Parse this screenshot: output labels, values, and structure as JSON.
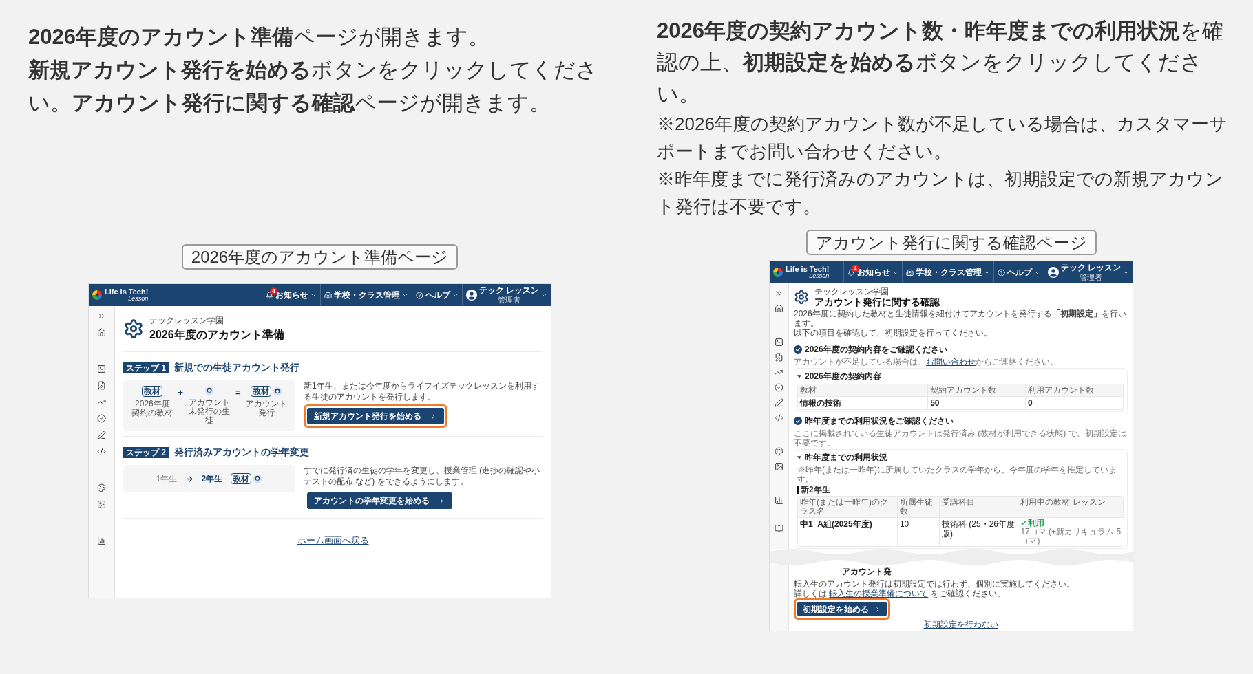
{
  "left": {
    "intro": [
      "**2026年度のアカウント準備**ページが開きます。",
      "**新規アカウント発行を始める**ボタンをクリックしてください。**アカウント発行に関する確認**ページが開きます。"
    ],
    "caption": "2026年度のアカウント準備ページ",
    "screen": {
      "header": {
        "brand": "Life is Tech!",
        "brand_sub": "Lesson",
        "nav": [
          {
            "kind": "notifications",
            "label": "お知らせ",
            "badge": "4"
          },
          {
            "kind": "school",
            "label": "学校・クラス管理"
          },
          {
            "kind": "help",
            "label": "ヘルプ"
          }
        ],
        "user": {
          "name": "テック レッスン",
          "role": "管理者"
        }
      },
      "school": "テックレッスン学園",
      "title": "2026年度のアカウント準備",
      "steps": [
        {
          "badge": "ステップ 1",
          "title": "新規での生徒アカウント発行",
          "illustration": {
            "kind": "formula",
            "book": "教材",
            "operators": [
              "+",
              "="
            ],
            "result_book": "教材",
            "labels": [
              "2026年度契約の教材",
              "アカウント未発行の生徒",
              "アカウント発行"
            ]
          },
          "description": "新1年生、または今年度からライフイズテックレッスンを利用する生徒のアカウントを発行します。",
          "button": "新規アカウント発行を始める",
          "highlighted": true
        },
        {
          "badge": "ステップ 2",
          "title": "発行済みアカウントの学年変更",
          "illustration": {
            "kind": "transition",
            "from": "1年生",
            "to": "2年生",
            "book": "教材"
          },
          "description": "すでに発行済の生徒の学年を変更し、授業管理 (進捗の確認や小テストの配布 など) をできるようにします。",
          "button": "アカウントの学年変更を始める",
          "highlighted": false
        }
      ],
      "back_link": "ホーム画面へ戻る"
    }
  },
  "right": {
    "intro": "**2026年度の契約アカウント数・昨年度までの利用状況**を確認の上、**初期設定を始める**ボタンをクリックしてください。",
    "notes": [
      "※2026年度の契約アカウント数が不足している場合は、カスタマーサポートまでお問い合わせください。",
      "※昨年度までに発行済みのアカウントは、初期設定での新規アカウント発行は不要です。"
    ],
    "caption": "アカウント発行に関する確認ページ",
    "screen": {
      "header": {
        "brand": "Life is Tech!",
        "brand_sub": "Lesson",
        "nav": [
          {
            "kind": "notifications",
            "label": "お知らせ",
            "badge": "4"
          },
          {
            "kind": "school",
            "label": "学校・クラス管理"
          },
          {
            "kind": "help",
            "label": "ヘルプ"
          }
        ],
        "user": {
          "name": "テック レッスン",
          "role": "管理者"
        }
      },
      "school": "テックレッスン学園",
      "title": "アカウント発行に関する確認",
      "intro": [
        "2026年度に契約した教材と生徒情報を紐付けてアカウントを発行する**「初期設定」**を行います。",
        "以下の項目を確認して、初期設定を行ってください。"
      ],
      "sections": [
        {
          "title": "2026年度の契約内容をご確認ください",
          "checked": true,
          "note": {
            "before": "アカウントが不足している場合は、",
            "link": "お問い合わせ",
            "after": "からご連絡ください。"
          },
          "card": {
            "title": "2026年度の契約内容",
            "expanded": true,
            "columns": [
              "教材",
              "契約アカウント数",
              "利用アカウント数"
            ],
            "rows": [
              {
                "cells": [
                  "情報の技術",
                  "50",
                  "0"
                ]
              }
            ]
          }
        },
        {
          "title": "昨年度までの利用状況をご確認ください",
          "checked": true,
          "note": {
            "before": "ここに掲載されている生徒アカウントは発行済み (教材が利用できる状態) で、初期設定は不要です。"
          },
          "card": {
            "title": "昨年度までの利用状況",
            "expanded": true,
            "footnote": "※昨年(または一昨年)に所属していたクラスの学年から、今年度の学年を推定しています。",
            "group": "新2年生",
            "columns": [
              "昨年(または一昨年)のクラス名",
              "所属生徒数",
              "受講科目",
              "利用中の教材 レッスン"
            ],
            "rows": [
              {
                "cells": [
                  "中1_A組(2025年度)",
                  "10",
                  "技術科 (25・26年度版)"
                ],
                "usage": {
                  "kind": "active",
                  "label": "利用",
                  "detail": "17コマ (+新カリキュラム 5コマ)"
                }
              }
            ]
          }
        }
      ],
      "cut_fragment": "アカウント発",
      "transfer": {
        "text": "転入生のアカウント発行は初期設定では行わず、個別に実施してください。",
        "before": "詳しくは ",
        "link": "転入生の授業準備について",
        "after": " をご確認ください。"
      },
      "button": "初期設定を始める",
      "highlighted": true,
      "skip_link": "初期設定を行わない"
    }
  }
}
